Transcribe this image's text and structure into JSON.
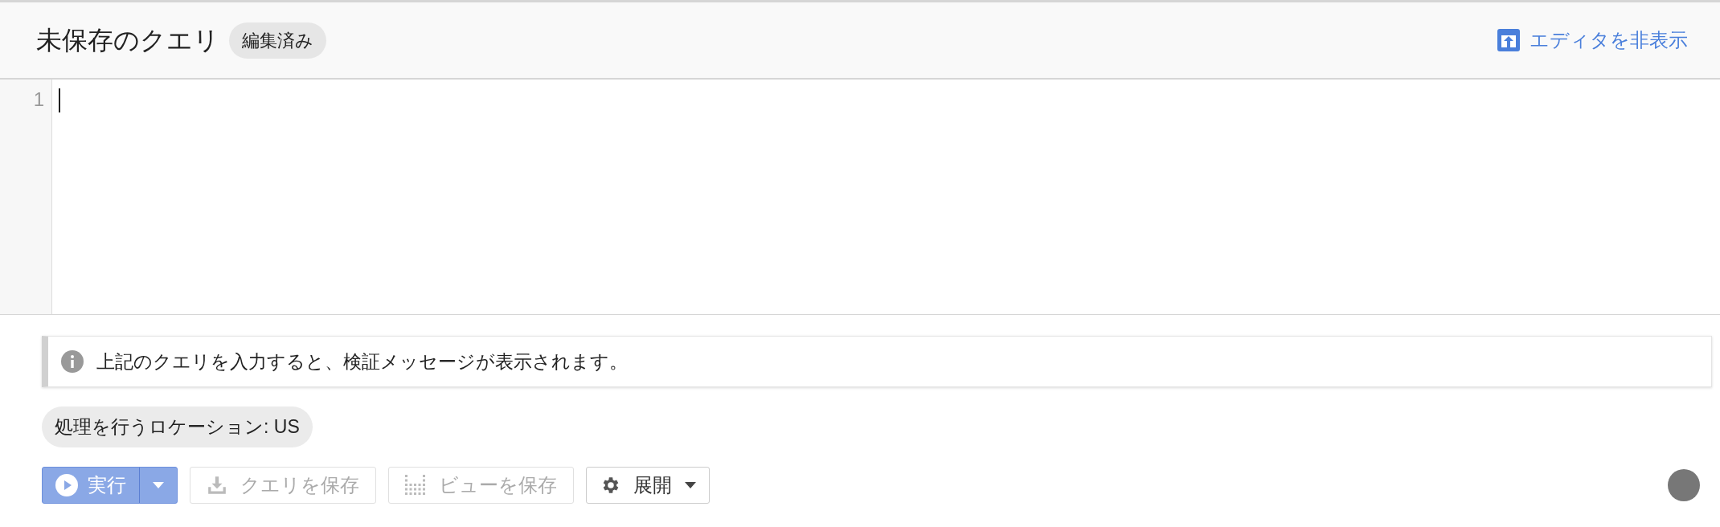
{
  "header": {
    "title": "未保存のクエリ",
    "badge": "編集済み",
    "hide_editor": "エディタを非表示"
  },
  "editor": {
    "line_numbers": [
      "1"
    ]
  },
  "info_message": "上記のクエリを入力すると、検証メッセージが表示されます。",
  "location_chip": "処理を行うロケーション: US",
  "toolbar": [
    {
      "kind": "run",
      "label": "実行",
      "disabled": false
    },
    {
      "kind": "save_query",
      "label": "クエリを保存",
      "disabled": true
    },
    {
      "kind": "save_view",
      "label": "ビューを保存",
      "disabled": true
    },
    {
      "kind": "expand",
      "label": "展開",
      "disabled": false
    }
  ]
}
